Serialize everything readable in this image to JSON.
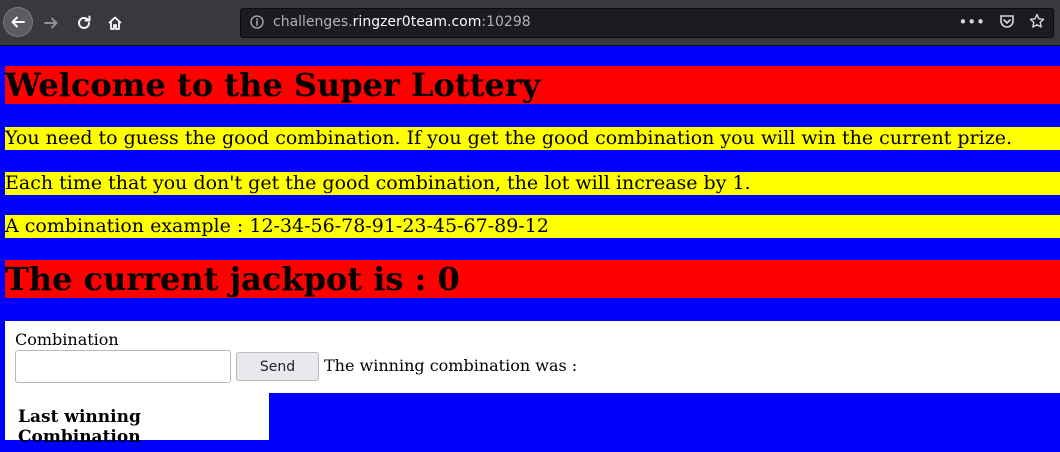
{
  "browser": {
    "url_prefix": "challenges.",
    "url_host": "ringzer0team.com",
    "url_port": ":10298"
  },
  "page": {
    "title": "Welcome to the Super Lottery",
    "line1": "You need to guess the good combination. If you get the good combination you will win the current prize.",
    "line2": "Each time that you don't get the good combination, the lot will increase by 1.",
    "line3": "A combination example : 12-34-56-78-91-23-45-67-89-12",
    "jackpot": "The current jackpot is : 0"
  },
  "form": {
    "label": "Combination",
    "input_value": "",
    "send_label": "Send",
    "winning_text": "The winning combination was :"
  },
  "last_winning": {
    "heading": "Last winning Combination"
  },
  "colors": {
    "background": "#0000ff",
    "heading_band": "#ff0000",
    "text_band": "#ffff00"
  }
}
